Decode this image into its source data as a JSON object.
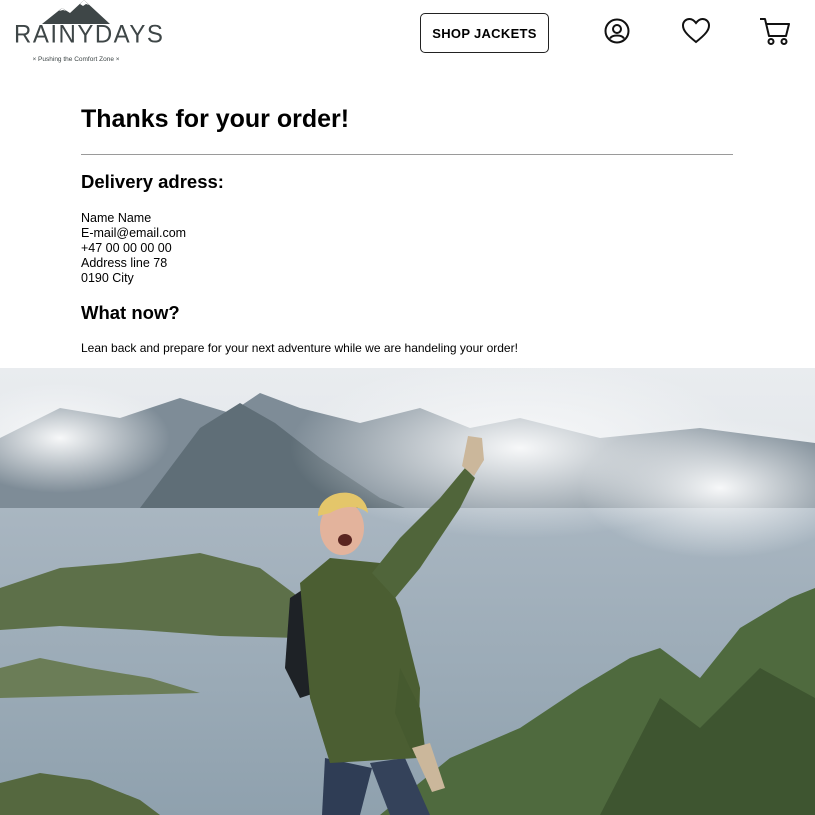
{
  "header": {
    "logo": {
      "wordmark": "RAINYDAYS",
      "tagline": "× Pushing the Comfort Zone ×"
    },
    "shop_button_label": "SHOP JACKETS",
    "icons": [
      "user-circle-icon",
      "heart-icon",
      "cart-icon"
    ]
  },
  "main": {
    "title": "Thanks for your order!",
    "delivery_heading": "Delivery adress:",
    "address_lines": [
      "Name Name",
      "E-mail@email.com",
      "+47 00 00 00 00",
      "Address line 78",
      "0190 City"
    ],
    "what_now_heading": "What now?",
    "what_now_text": "Lean back and prepare for your next adventure while we are handeling your order!"
  },
  "colors": {
    "logo": "#3e4647",
    "divider": "#9a9a9a",
    "jacket": "#4b5e32"
  }
}
